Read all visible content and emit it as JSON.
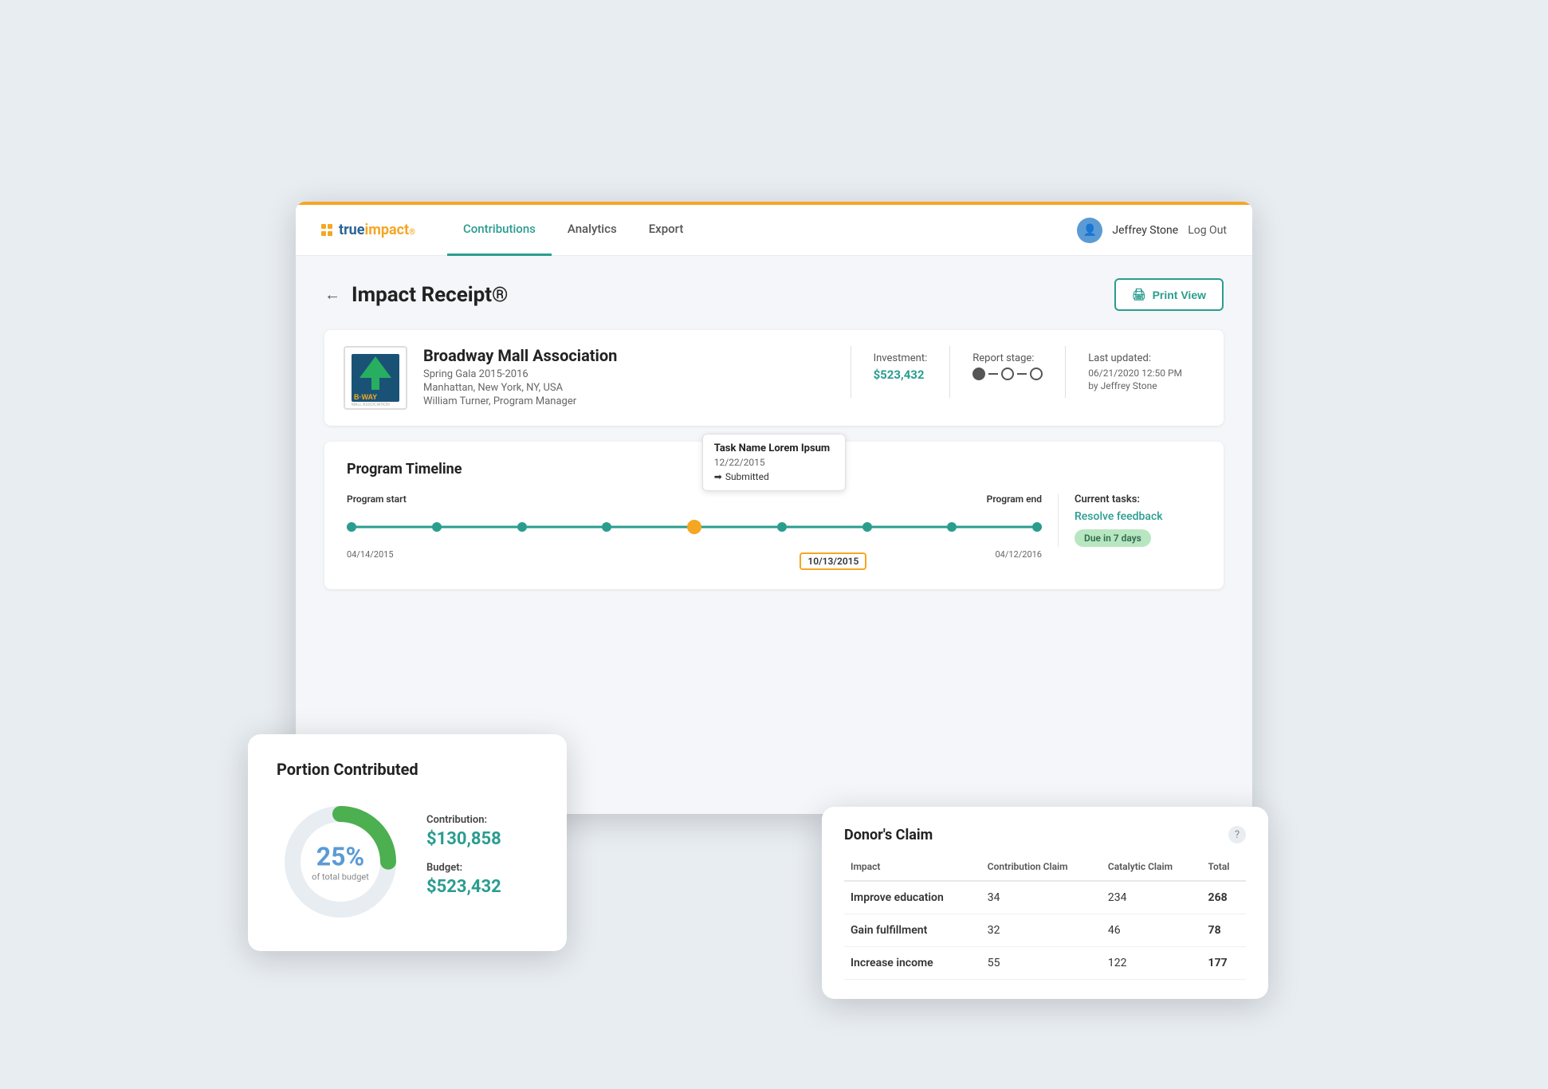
{
  "brand": {
    "name": "true impact",
    "name_styled": "true impact"
  },
  "nav": {
    "tabs": [
      {
        "label": "Contributions",
        "active": true
      },
      {
        "label": "Analytics",
        "active": false
      },
      {
        "label": "Export",
        "active": false
      }
    ],
    "user": {
      "name": "Jeffrey Stone",
      "logout": "Log Out"
    }
  },
  "page": {
    "title": "Impact Receipt®",
    "back_label": "←",
    "print_label": "Print View"
  },
  "org": {
    "name": "Broadway Mall Association",
    "program": "Spring Gala 2015-2016",
    "location": "Manhattan, New York, NY, USA",
    "manager": "William Turner, Program Manager",
    "investment_label": "Investment:",
    "investment_value": "$523,432",
    "report_stage_label": "Report stage:",
    "last_updated_label": "Last updated:",
    "last_updated_value": "06/21/2020 12:50 PM",
    "last_updated_by": "by Jeffrey Stone"
  },
  "timeline": {
    "title": "Program Timeline",
    "program_start_label": "Program start",
    "program_end_label": "Program end",
    "start_date": "04/14/2015",
    "end_date": "04/12/2016",
    "current_date": "10/13/2015",
    "tooltip": {
      "task_name": "Task Name Lorem Ipsum",
      "date": "12/22/2015",
      "status": "Submitted"
    },
    "current_tasks_label": "Current tasks:",
    "resolve_feedback": "Resolve feedback",
    "due_badge": "Due in 7 days"
  },
  "portion": {
    "title": "Portion Contributed",
    "percent": "25%",
    "percent_sub": "of total budget",
    "contribution_label": "Contribution:",
    "contribution_value": "$130,858",
    "budget_label": "Budget:",
    "budget_value": "$523,432"
  },
  "donors_claim": {
    "title": "Donor's Claim",
    "help": "?",
    "columns": [
      "Impact",
      "Contribution Claim",
      "Catalytic Claim",
      "Total"
    ],
    "rows": [
      {
        "impact": "Improve education",
        "contribution": "34",
        "catalytic": "234",
        "total": "268"
      },
      {
        "impact": "Gain fulfillment",
        "contribution": "32",
        "catalytic": "46",
        "total": "78"
      },
      {
        "impact": "Increase income",
        "contribution": "55",
        "catalytic": "122",
        "total": "177"
      }
    ]
  }
}
